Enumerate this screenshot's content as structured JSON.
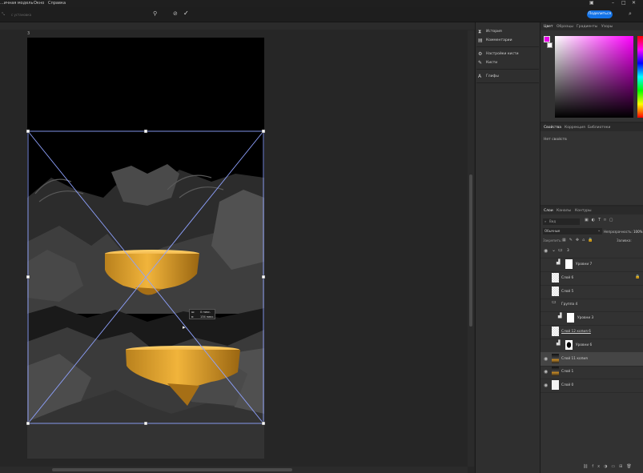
{
  "menu": {
    "items": [
      "...ичная модель",
      "Окно",
      "Справка"
    ]
  },
  "options": {
    "field_text": "с установка",
    "share_label": "Поделиться"
  },
  "canvas": {
    "doc_label": "3"
  },
  "transform_info": {
    "line1": "0 пикс.",
    "line2": "134 пикс."
  },
  "side_panel": {
    "items": [
      {
        "label": "История"
      },
      {
        "label": "Комментарии"
      },
      {
        "label": "Настройки кисти"
      },
      {
        "label": "Кисти"
      },
      {
        "label": "Глифы"
      }
    ]
  },
  "color_panel": {
    "tabs": [
      "Цвет",
      "Образцы",
      "Градиенты",
      "Узоры"
    ],
    "foreground_color": "#e800e8",
    "background_color": "#ffffff",
    "hue_color": "#ff00ff"
  },
  "properties_panel": {
    "tabs": [
      "Свойства",
      "Коррекция",
      "Библиотеки"
    ],
    "status": "Нет свойств"
  },
  "layers_panel": {
    "tabs": [
      "Слои",
      "Каналы",
      "Контуры"
    ],
    "search_placeholder": "Вид",
    "blend_mode": "Обычные",
    "opacity_label": "Непрозрачность:",
    "opacity_value": "100%",
    "lock_label": "Закрепить:",
    "fill_label": "Заливка:",
    "group_label": "3",
    "layers": [
      {
        "name": "Уровни 7",
        "visible": false
      },
      {
        "name": "Слой 6",
        "visible": false
      },
      {
        "name": "Слой 5",
        "visible": false
      },
      {
        "name": "Группа 4",
        "visible": false
      },
      {
        "name": "Уровни 3",
        "visible": false
      },
      {
        "name": "Слой 12 копия 6",
        "visible": false
      },
      {
        "name": "Уровни 6",
        "visible": false
      },
      {
        "name": "Слой 11 копия",
        "visible": true
      },
      {
        "name": "Слой 1",
        "visible": true
      },
      {
        "name": "Слой 0",
        "visible": true
      }
    ]
  }
}
